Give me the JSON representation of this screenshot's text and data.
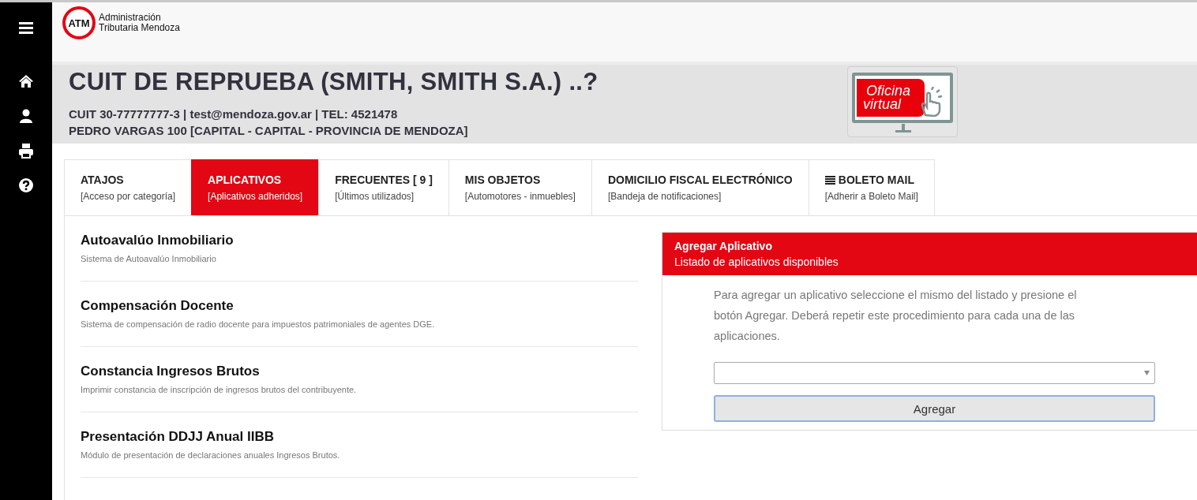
{
  "logo": {
    "mark": "ATM",
    "lines": [
      "Administración",
      "Tributaria Mendoza"
    ]
  },
  "header": {
    "title": "CUIT DE REPRUEBA (SMITH, SMITH S.A.) ..?",
    "contact": "CUIT 30-77777777-3 | test@mendoza.gov.ar  | TEL: 4521478",
    "address": "PEDRO VARGAS 100 [CAPITAL - CAPITAL - PROVINCIA DE MENDOZA]",
    "badge": [
      "Oficina",
      "virtual"
    ]
  },
  "tabs": [
    {
      "label": "ATAJOS",
      "sub": "[Acceso por categoría]",
      "selected": false
    },
    {
      "label": "APLICATIVOS",
      "sub": "[Aplicativos adheridos]",
      "selected": true
    },
    {
      "label": "FRECUENTES [ 9 ]",
      "sub": "[Últimos utilizados]",
      "selected": false
    },
    {
      "label": "MIS OBJETOS",
      "sub": "[Automotores - inmuebles]",
      "selected": false
    },
    {
      "label": "DOMICILIO FISCAL ELECTRÓNICO",
      "sub": "[Bandeja de notificaciones]",
      "selected": false
    },
    {
      "label": "BOLETO MAIL",
      "sub": "[Adherir a Boleto Mail]",
      "selected": false,
      "kind": "icon"
    }
  ],
  "apps": [
    {
      "name": "Autoavalúo Inmobiliario",
      "description": "Sistema de Autoavalúo Inmobiliario"
    },
    {
      "name": "Compensación Docente",
      "description": "Sistema de compensación de radio docente para impuestos patrimoniales de agentes DGE."
    },
    {
      "name": "Constancia Ingresos Brutos",
      "description": "Imprimir constancia de inscripción de ingresos brutos del contribuyente."
    },
    {
      "name": "Presentación DDJJ Anual IIBB",
      "description": "Módulo de presentación de declaraciones anuales Ingresos Brutos."
    }
  ],
  "panel": {
    "title": "Agregar Aplicativo",
    "subtitle": "Listado de aplicativos disponibles",
    "instructions": "Para agregar un aplicativo seleccione el mismo del listado y presione el botón Agregar. Deberá repetir este procedimiento para cada una de las aplicaciones.",
    "button": "Agregar"
  }
}
